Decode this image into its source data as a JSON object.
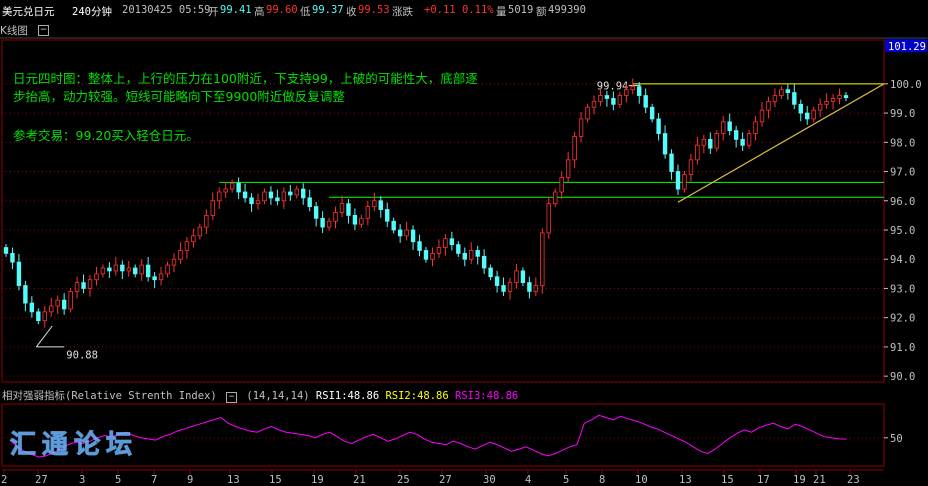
{
  "header": {
    "symbol": "美元兑日元",
    "period": "240分钟",
    "datetime": "20130425 05:59",
    "open_label": "开",
    "open": "99.41",
    "high_label": "高",
    "high": "99.60",
    "low_label": "低",
    "low": "99.37",
    "close_label": "收",
    "close": "99.53",
    "change_label": "涨跌",
    "change": "+0.11",
    "change_pct": "0.11%",
    "volume_label": "量",
    "volume": "5019",
    "amount_label": "额",
    "amount": "499390"
  },
  "panel_title": "K线图",
  "annotation": {
    "line1": "日元四时图：整体上，上行的压力在100附近，下支持99，上破的可能性大，底部逐",
    "line2": "步抬高，动力较强。短线可能略向下至9900附近做反复调整",
    "line3": "参考交易：99.20买入轻仓日元。"
  },
  "rsi": {
    "title": "相对强弱指标(Relative Strenth Index)",
    "params": "(14,14,14)",
    "rsi1": "RSI1:48.86",
    "rsi2": "RSI2:48.86",
    "rsi3": "RSI3:48.86",
    "tick_label": "50"
  },
  "watermark": "汇通论坛",
  "colors": {
    "up": "#ff3232",
    "down": "#54fcfc",
    "support": "#00ff00",
    "resistance": "#ffff00",
    "rsi_line": "#ff00ff",
    "grid": "#8b0000",
    "price_badge_bg": "#0000c8"
  },
  "chart_data": {
    "type": "candlestick",
    "price_axis": {
      "ticks": [
        "100.0",
        "99.0",
        "98.0",
        "97.0",
        "96.0",
        "95.0",
        "94.0",
        "93.0",
        "92.0",
        "91.0",
        "90.0"
      ],
      "ylim": [
        89.8,
        101.5
      ],
      "current_price_badge": "101.29"
    },
    "date_ticks": [
      "2",
      "27",
      "3",
      "5",
      "7",
      "9",
      "13",
      "15",
      "19",
      "21",
      "25",
      "27",
      "30",
      "4",
      "5",
      "8",
      "10",
      "13",
      "15",
      "17",
      "19",
      "21",
      "23"
    ],
    "marks": {
      "low_label": "90.88",
      "high_label": "99.94"
    },
    "levels": {
      "resistance": 100.0,
      "support_upper": 96.63,
      "support_lower": 96.12
    },
    "trendline": {
      "from_price": 95.95,
      "to_price": 100.0
    },
    "series_close": [
      94.2,
      93.9,
      93.1,
      92.5,
      92.2,
      91.9,
      92.2,
      92.4,
      92.6,
      92.3,
      92.9,
      93.2,
      93.0,
      93.3,
      93.5,
      93.7,
      93.6,
      93.8,
      93.6,
      93.7,
      93.5,
      93.8,
      93.4,
      93.3,
      93.5,
      93.8,
      94.0,
      94.3,
      94.6,
      94.8,
      95.1,
      95.5,
      96.0,
      96.3,
      96.4,
      96.6,
      96.3,
      96.1,
      95.9,
      96.0,
      96.3,
      96.1,
      96.0,
      96.3,
      96.2,
      96.4,
      96.1,
      95.8,
      95.4,
      95.1,
      95.3,
      95.6,
      95.9,
      95.5,
      95.2,
      95.4,
      95.8,
      96.0,
      95.7,
      95.3,
      95.0,
      94.8,
      95.0,
      94.6,
      94.3,
      94.0,
      94.2,
      94.4,
      94.7,
      94.5,
      94.2,
      94.0,
      94.3,
      94.1,
      93.7,
      93.4,
      93.1,
      92.9,
      93.2,
      93.6,
      93.2,
      92.9,
      93.1,
      94.9,
      95.9,
      96.3,
      96.8,
      97.4,
      98.2,
      98.8,
      99.2,
      99.4,
      99.6,
      99.5,
      99.3,
      99.6,
      99.8,
      99.9,
      99.6,
      99.2,
      98.8,
      98.3,
      97.6,
      97.0,
      96.4,
      96.9,
      97.4,
      97.9,
      98.1,
      97.8,
      98.3,
      98.7,
      98.4,
      98.1,
      97.9,
      98.3,
      98.7,
      99.1,
      99.4,
      99.6,
      99.8,
      99.7,
      99.3,
      99.0,
      98.8,
      99.1,
      99.3,
      99.4,
      99.5,
      99.6,
      99.53
    ],
    "rsi_series": [
      48,
      42,
      38,
      35,
      33,
      34,
      37,
      40,
      44,
      46,
      45,
      47,
      50,
      52,
      51,
      53,
      55,
      52,
      50,
      49,
      48,
      51,
      53,
      56,
      58,
      60,
      62,
      64,
      66,
      68,
      63,
      60,
      58,
      56,
      55,
      58,
      60,
      57,
      55,
      54,
      53,
      52,
      50,
      53,
      55,
      51,
      47,
      45,
      48,
      51,
      53,
      50,
      47,
      49,
      52,
      55,
      53,
      49,
      46,
      45,
      44,
      47,
      45,
      42,
      40,
      43,
      46,
      44,
      41,
      38,
      40,
      42,
      39,
      36,
      34,
      36,
      39,
      42,
      44,
      63,
      66,
      70,
      68,
      66,
      69,
      67,
      65,
      63,
      60,
      58,
      55,
      52,
      49,
      46,
      42,
      38,
      36,
      40,
      45,
      50,
      54,
      57,
      55,
      59,
      61,
      63,
      60,
      58,
      62,
      60,
      57,
      54,
      51,
      50,
      49,
      48.86
    ]
  }
}
